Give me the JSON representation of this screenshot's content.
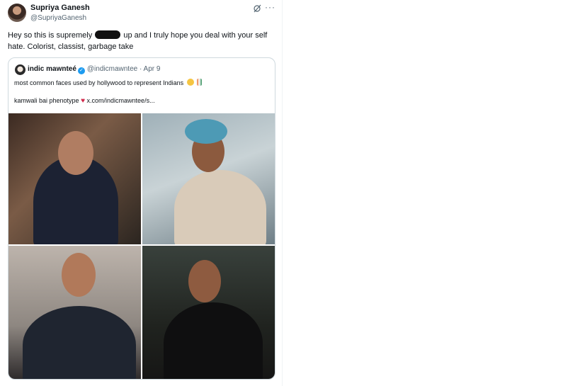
{
  "tweet": {
    "author_name": "Supriya Ganesh",
    "author_handle": "@SupriyaGanesh",
    "text_before_redaction": "Hey so this is supremely",
    "text_after_redaction": "up and I truly hope you deal with your self hate. Colorist, classist, garbage take",
    "more_label": "···"
  },
  "quoted": {
    "author_name": "indic mawnteé",
    "author_handle": "@indicmawntee",
    "date": "Apr 9",
    "line1": "most common faces used by hollywood to represent Indians",
    "line2_text": "kamwali bai phenotype",
    "line2_link": "x.com/indicmawntee/s...",
    "images": [
      "photo-1",
      "photo-2",
      "photo-3",
      "photo-4"
    ]
  },
  "colors": {
    "text": "#0f1419",
    "secondary": "#536471",
    "border": "#cfd9de",
    "verified": "#1d9bf0"
  }
}
